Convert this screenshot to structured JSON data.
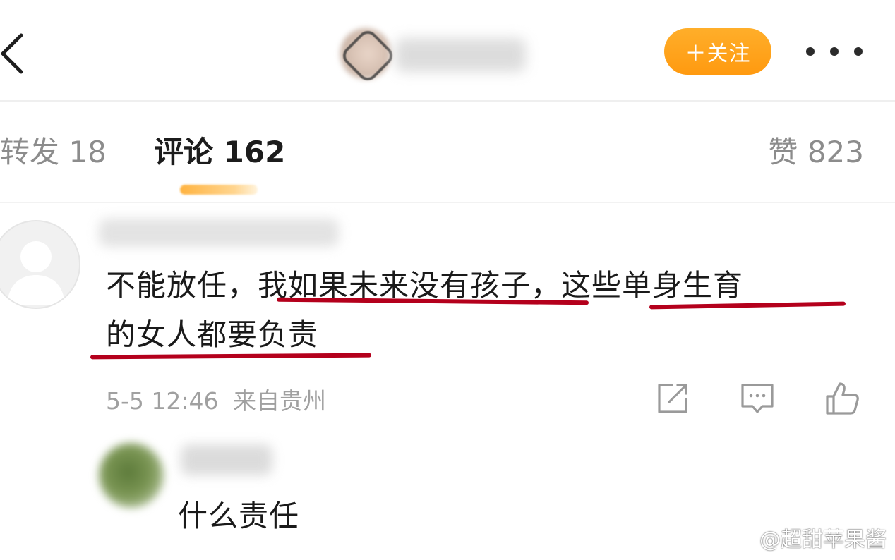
{
  "header": {
    "follow_label": "＋关注"
  },
  "tabs": {
    "reposts": "转发 18",
    "comments": "评论 162",
    "likes": "赞 823"
  },
  "comment": {
    "text_plain": "不能放任，",
    "text_marked_1": "我如果未来没有孩子",
    "text_sep": "，",
    "text_marked_2": "这些单身生育",
    "text_marked_3": "的女人都要负责",
    "time": "5-5 12:46",
    "location": "来自贵州"
  },
  "reply": {
    "text": "什么责任"
  },
  "watermark": {
    "text": "@超甜苹果酱"
  },
  "colors": {
    "accent_orange": "#ff9a10",
    "underline_red": "#b4001c",
    "muted_text": "#8c8c8c"
  },
  "icons": [
    "chevron-left-icon",
    "more-icon",
    "share-icon",
    "comment-icon",
    "like-icon",
    "weibo-icon"
  ]
}
